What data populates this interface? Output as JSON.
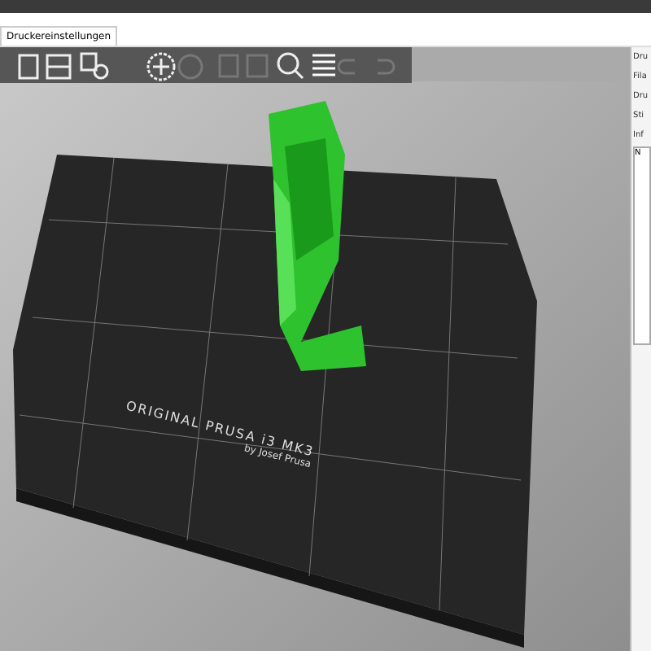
{
  "tabs": [
    {
      "label": "Druckereinstellungen",
      "selected": true
    }
  ],
  "bed": {
    "brand": "ORIGINAL PRUSA i3 MK3",
    "maker": "by Josef Prusa"
  },
  "panel": {
    "labels": [
      "Dru",
      "Fila",
      "Dru",
      "Sti",
      "Inf"
    ],
    "list_header": "N"
  }
}
